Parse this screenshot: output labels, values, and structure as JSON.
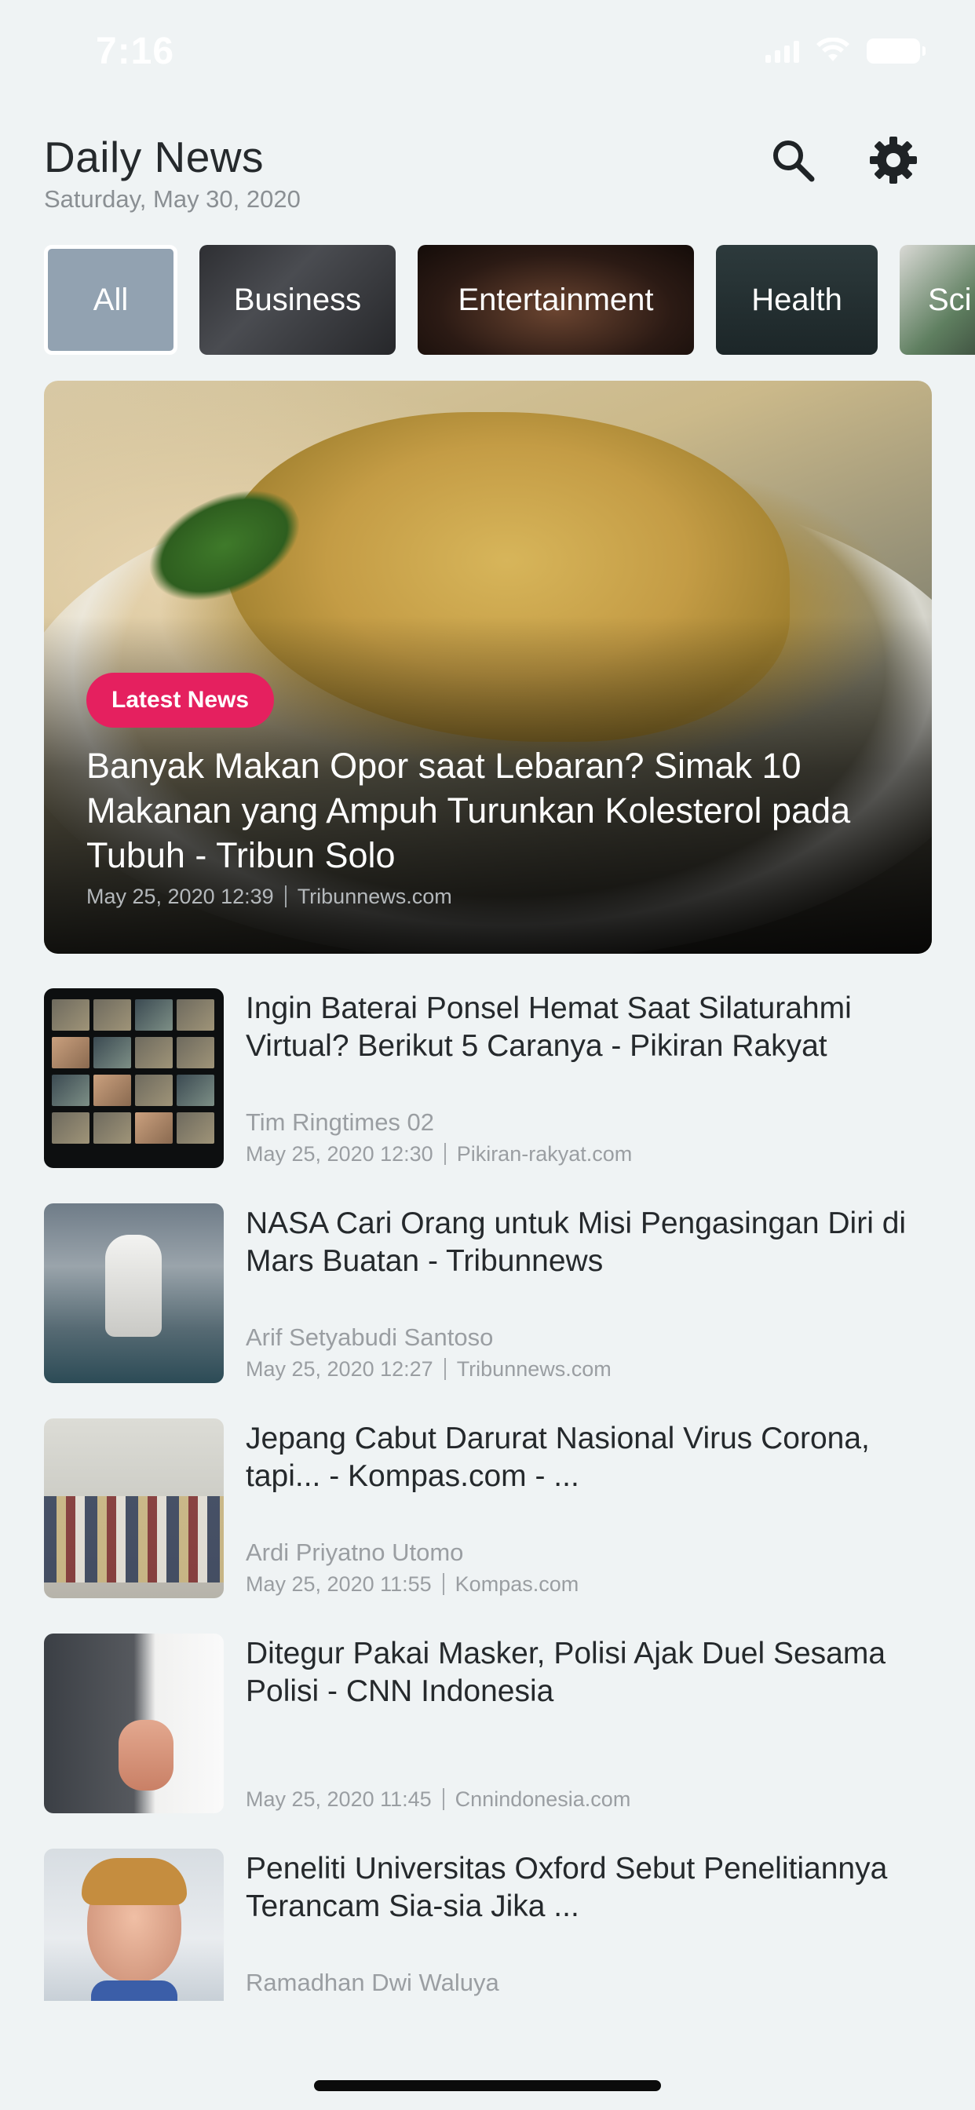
{
  "status_bar": {
    "time": "7:16"
  },
  "header": {
    "title": "Daily News",
    "date": "Saturday, May 30, 2020"
  },
  "icons": {
    "search": "search-icon",
    "settings": "gear-icon"
  },
  "categories": [
    {
      "label": "All",
      "selected": true
    },
    {
      "label": "Business",
      "selected": false
    },
    {
      "label": "Entertainment",
      "selected": false
    },
    {
      "label": "Health",
      "selected": false
    },
    {
      "label": "Sci",
      "selected": false
    }
  ],
  "hero": {
    "badge": "Latest News",
    "title": "Banyak Makan Opor saat Lebaran? Simak 10 Makanan yang Ampuh Turunkan Kolesterol pada Tubuh - Tribun Solo",
    "datetime": "May 25, 2020 12:39",
    "source": "Tribunnews.com"
  },
  "articles": [
    {
      "title": "Ingin Baterai Ponsel Hemat Saat Silaturahmi Virtual? Berikut 5 Caranya - Pikiran Rakyat",
      "author": "Tim Ringtimes 02",
      "datetime": "May 25, 2020 12:30",
      "source": "Pikiran-rakyat.com"
    },
    {
      "title": "NASA Cari Orang untuk Misi Pengasingan Diri di Mars Buatan - Tribunnews",
      "author": "Arif Setyabudi Santoso",
      "datetime": "May 25, 2020 12:27",
      "source": "Tribunnews.com"
    },
    {
      "title": "Jepang Cabut Darurat Nasional Virus Corona, tapi... - Kompas.com - ...",
      "author": "Ardi Priyatno Utomo",
      "datetime": "May 25, 2020 11:55",
      "source": "Kompas.com"
    },
    {
      "title": "Ditegur Pakai Masker, Polisi Ajak Duel Sesama Polisi - CNN Indonesia",
      "author": "",
      "datetime": "May 25, 2020 11:45",
      "source": "Cnnindonesia.com"
    },
    {
      "title": "Peneliti Universitas Oxford Sebut Penelitiannya Terancam Sia-sia Jika ...",
      "author": "Ramadhan Dwi Waluya",
      "datetime": "",
      "source": ""
    }
  ],
  "colors": {
    "background": "#eff3f4",
    "badge": "#e5205f",
    "selected_chip": "#92a2b1"
  }
}
